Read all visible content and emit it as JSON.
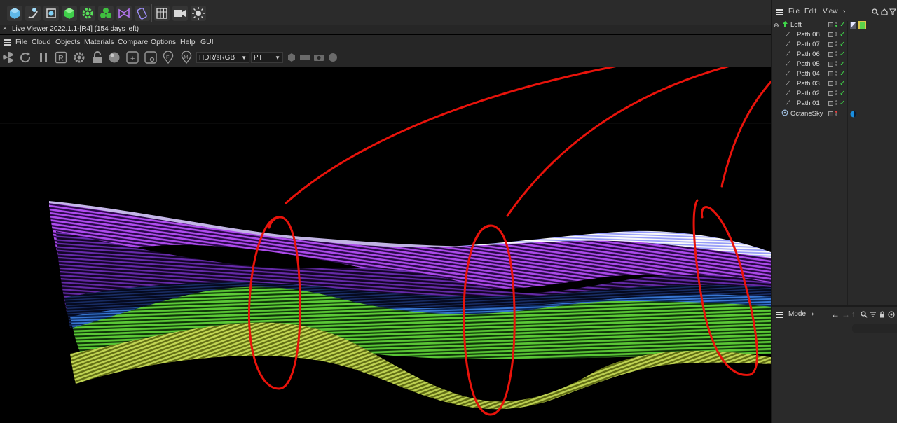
{
  "viewer": {
    "close_glyph": "×",
    "title": "Live Viewer 2022.1.1-[R4] (154 days left)",
    "menu": [
      "File",
      "Cloud",
      "Objects",
      "Materials",
      "Compare",
      "Options",
      "Help",
      "GUI"
    ],
    "toolbar": {
      "icons": [
        "start-render-icon",
        "restart-render-icon",
        "pause-render-icon",
        "region-render-icon",
        "settings-gear-icon",
        "lock-icon",
        "material-ball-icon",
        "add-material-icon",
        "clay-mode-icon",
        "focus-pick-icon",
        "material-pick-icon"
      ],
      "region_letter": "R",
      "focus_letter": "F",
      "material_letter": "M",
      "color_space": "HDR/sRGB",
      "kernel": "PT",
      "trailing_icons": [
        "hexagon-icon",
        "film-icon",
        "camera-icon",
        "circle-icon"
      ]
    }
  },
  "main_toolbar": {
    "icons": [
      "cube-icon",
      "bend-icon",
      "focus-icon",
      "cube-green-icon",
      "gear-green-icon",
      "cloner-icon",
      "deformer-icon",
      "spline-mask-icon",
      "grid-icon",
      "camera-icon",
      "light-icon"
    ]
  },
  "object_manager": {
    "menu": [
      "File",
      "Edit",
      "View",
      "›"
    ],
    "objects": [
      {
        "name": "Loft",
        "indent": 0,
        "check": "✓"
      },
      {
        "name": "Path 08",
        "indent": 1,
        "check": "✓"
      },
      {
        "name": "Path 07",
        "indent": 1,
        "check": "✓"
      },
      {
        "name": "Path 06",
        "indent": 1,
        "check": "✓"
      },
      {
        "name": "Path 05",
        "indent": 1,
        "check": "✓"
      },
      {
        "name": "Path 04",
        "indent": 1,
        "check": "✓"
      },
      {
        "name": "Path 03",
        "indent": 1,
        "check": "✓"
      },
      {
        "name": "Path 02",
        "indent": 1,
        "check": "✓"
      },
      {
        "name": "Path 01",
        "indent": 1,
        "check": "✓"
      },
      {
        "name": "OctaneSky",
        "indent": 0,
        "check": ""
      }
    ]
  },
  "attribute_manager": {
    "mode_label": "Mode",
    "chevron": "›"
  },
  "colors": {
    "annotation": "#e8130b",
    "check": "#3fd64a",
    "purple": "#a646f0",
    "green": "#5ed23a",
    "yellow_green": "#c8e050",
    "blue": "#2f6fd0"
  }
}
